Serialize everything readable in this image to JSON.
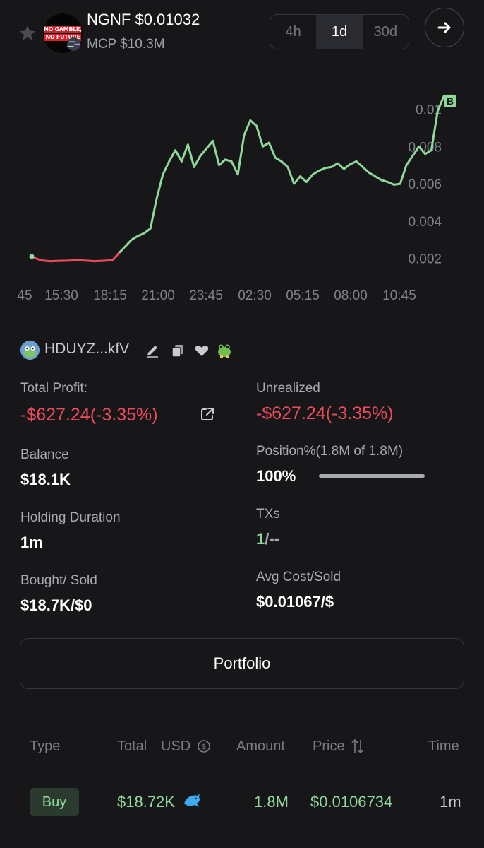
{
  "header": {
    "token_symbol": "NGNF",
    "token_price": "$0.01032",
    "mcp": "MCP $10.3M",
    "avatar_text_1": "NO GAMBLE,",
    "avatar_text_2": "NO FUTURE",
    "timeframes": [
      "4h",
      "1d",
      "30d"
    ],
    "active_timeframe": "1d",
    "star_icon": "star-icon",
    "go_icon": "arrow-right-icon"
  },
  "chart_data": {
    "type": "line",
    "x_ticks": [
      "45",
      "15:30",
      "18:15",
      "21:00",
      "23:45",
      "02:30",
      "05:15",
      "08:00",
      "10:45"
    ],
    "y_ticks": [
      "0.01",
      "0.008",
      "0.006",
      "0.004",
      "0.002"
    ],
    "ylim": [
      0.001,
      0.0115
    ],
    "series": [
      {
        "color_loss": "#ee4a5c",
        "color_gain": "#8fd99b",
        "values": [
          0.0021,
          0.00195,
          0.00187,
          0.00185,
          0.00186,
          0.00187,
          0.00188,
          0.0019,
          0.00189,
          0.00187,
          0.00185,
          0.00186,
          0.00188,
          0.00192,
          0.0023,
          0.00265,
          0.003,
          0.0032,
          0.00335,
          0.0036,
          0.0052,
          0.0065,
          0.0072,
          0.0078,
          0.0072,
          0.0081,
          0.0069,
          0.0075,
          0.0079,
          0.0083,
          0.007,
          0.0073,
          0.0072,
          0.0065,
          0.0086,
          0.0094,
          0.0091,
          0.008,
          0.0082,
          0.0074,
          0.0072,
          0.0069,
          0.006,
          0.0064,
          0.0061,
          0.0065,
          0.0067,
          0.00685,
          0.0069,
          0.0071,
          0.0068,
          0.00705,
          0.0072,
          0.0069,
          0.0066,
          0.0064,
          0.0062,
          0.0061,
          0.00595,
          0.006,
          0.007,
          0.0075,
          0.008,
          0.0076,
          0.0078,
          0.0099,
          0.0107,
          0.0107
        ],
        "loss_points": 14
      }
    ],
    "marker": "B",
    "marker_value": 0.01067
  },
  "wallet": {
    "name": "HDUYZ...kfV",
    "icons": [
      "edit-icon",
      "copy-icon",
      "heart-icon",
      "frog-icon"
    ]
  },
  "stats": {
    "total_profit_label": "Total Profit:",
    "total_profit_value": "-$627.24(-3.35%)",
    "unrealized_label": "Unrealized",
    "unrealized_value": "-$627.24(-3.35%)",
    "balance_label": "Balance",
    "balance_value": "$18.1K",
    "position_label": "Position%(1.8M of 1.8M)",
    "position_value": "100%",
    "position_fraction": 1.0,
    "holding_label": "Holding Duration",
    "holding_value": "1m",
    "txs_label": "TXs",
    "txs_buys": "1",
    "txs_rest": "/--",
    "bought_label": "Bought/ Sold",
    "bought_value": "$18.7K/$0",
    "avg_label": "Avg Cost/Sold",
    "avg_value": "$0.01067/$"
  },
  "portfolio_button": "Portfolio",
  "table": {
    "headers": [
      "Type",
      "Total",
      "USD",
      "Amount",
      "Price",
      "Time"
    ],
    "rows": [
      {
        "type": "Buy",
        "total": "$18.72K",
        "amount": "1.8M",
        "price": "$0.0106734",
        "time": "1m",
        "badge_icon": "dolphin-icon"
      }
    ]
  }
}
